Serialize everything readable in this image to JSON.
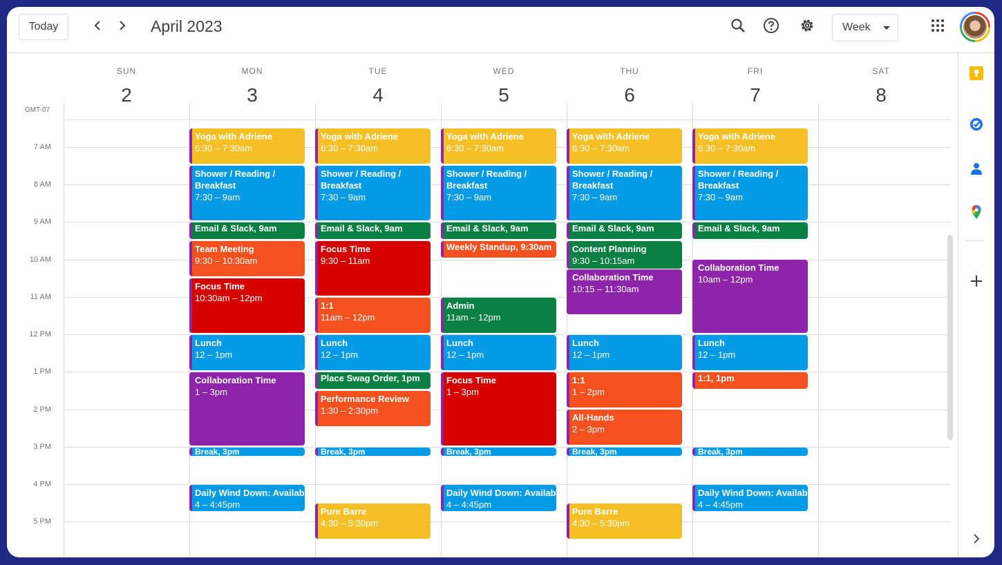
{
  "toolbar": {
    "today_label": "Today",
    "title": "April 2023",
    "view_label": "Week"
  },
  "timezone": "GMT-07",
  "days": [
    {
      "name": "SUN",
      "num": "2"
    },
    {
      "name": "MON",
      "num": "3"
    },
    {
      "name": "TUE",
      "num": "4"
    },
    {
      "name": "WED",
      "num": "5"
    },
    {
      "name": "THU",
      "num": "6"
    },
    {
      "name": "FRI",
      "num": "7"
    },
    {
      "name": "SAT",
      "num": "8"
    }
  ],
  "hours": [
    "7 AM",
    "8 AM",
    "9 AM",
    "10 AM",
    "11 AM",
    "12 PM",
    "1 PM",
    "2 PM",
    "3 PM",
    "4 PM",
    "5 PM"
  ],
  "colors": {
    "yellow": "#f6bf26",
    "blue": "#039be5",
    "green": "#0b8043",
    "orange": "#f4511e",
    "red": "#d50000",
    "purple": "#8e24aa"
  },
  "icons": {
    "search": "search-icon",
    "help": "help-icon",
    "settings": "gear-icon",
    "apps": "apps-grid-icon",
    "keep": "keep-icon",
    "tasks": "tasks-icon",
    "contacts": "contacts-icon",
    "maps": "maps-icon",
    "add": "plus-icon",
    "expand": "chevron-right-icon"
  },
  "events": {
    "mon": [
      {
        "title": "Yoga with Adriene",
        "time": "6:30 – 7:30am",
        "color": "yellow"
      },
      {
        "title": "Shower / Reading / Breakfast",
        "time": "7:30 – 9am",
        "color": "blue"
      },
      {
        "title": "Email & Slack, 9am",
        "time": "",
        "color": "green"
      },
      {
        "title": "Team Meeting",
        "time": "9:30 – 10:30am",
        "color": "orange"
      },
      {
        "title": "Focus Time",
        "time": "10:30am – 12pm",
        "color": "red"
      },
      {
        "title": "Lunch",
        "time": "12 – 1pm",
        "color": "blue"
      },
      {
        "title": "Collaboration Time",
        "time": "1 – 3pm",
        "color": "purple"
      },
      {
        "title": "Break, 3pm",
        "time": "",
        "color": "blue"
      },
      {
        "title": "Daily Wind Down: Available",
        "time": "4 – 4:45pm",
        "color": "blue"
      }
    ],
    "tue": [
      {
        "title": "Yoga with Adriene",
        "time": "6:30 – 7:30am",
        "color": "yellow"
      },
      {
        "title": "Shower / Reading / Breakfast",
        "time": "7:30 – 9am",
        "color": "blue"
      },
      {
        "title": "Email & Slack, 9am",
        "time": "",
        "color": "green"
      },
      {
        "title": "Focus Time",
        "time": "9:30 – 11am",
        "color": "red"
      },
      {
        "title": "1:1",
        "time": "11am – 12pm",
        "color": "orange"
      },
      {
        "title": "Lunch",
        "time": "12 – 1pm",
        "color": "blue"
      },
      {
        "title": "Place Swag Order, 1pm",
        "time": "",
        "color": "green"
      },
      {
        "title": "Performance Review",
        "time": "1:30 – 2:30pm",
        "color": "orange"
      },
      {
        "title": "Break, 3pm",
        "time": "",
        "color": "blue"
      },
      {
        "title": "Pure Barre",
        "time": "4:30 – 5:30pm",
        "color": "yellow"
      }
    ],
    "wed": [
      {
        "title": "Yoga with Adriene",
        "time": "6:30 – 7:30am",
        "color": "yellow"
      },
      {
        "title": "Shower / Reading / Breakfast",
        "time": "7:30 – 9am",
        "color": "blue"
      },
      {
        "title": "Email & Slack, 9am",
        "time": "",
        "color": "green"
      },
      {
        "title": "Weekly Standup, 9:30am",
        "time": "",
        "color": "orange"
      },
      {
        "title": "Admin",
        "time": "11am – 12pm",
        "color": "green"
      },
      {
        "title": "Lunch",
        "time": "12 – 1pm",
        "color": "blue"
      },
      {
        "title": "Focus Time",
        "time": "1 – 3pm",
        "color": "red"
      },
      {
        "title": "Break, 3pm",
        "time": "",
        "color": "blue"
      },
      {
        "title": "Daily Wind Down: Available",
        "time": "4 – 4:45pm",
        "color": "blue"
      }
    ],
    "thu": [
      {
        "title": "Yoga with Adriene",
        "time": "6:30 – 7:30am",
        "color": "yellow"
      },
      {
        "title": "Shower / Reading / Breakfast",
        "time": "7:30 – 9am",
        "color": "blue"
      },
      {
        "title": "Email & Slack, 9am",
        "time": "",
        "color": "green"
      },
      {
        "title": "Content Planning",
        "time": "9:30 – 10:15am",
        "color": "green"
      },
      {
        "title": "Collaboration Time",
        "time": "10:15 – 11:30am",
        "color": "purple"
      },
      {
        "title": "Lunch",
        "time": "12 – 1pm",
        "color": "blue"
      },
      {
        "title": "1:1",
        "time": "1 – 2pm",
        "color": "orange"
      },
      {
        "title": "All-Hands",
        "time": "2 – 3pm",
        "color": "orange"
      },
      {
        "title": "Break, 3pm",
        "time": "",
        "color": "blue"
      },
      {
        "title": "Pure Barre",
        "time": "4:30 – 5:30pm",
        "color": "yellow"
      }
    ],
    "fri": [
      {
        "title": "Yoga with Adriene",
        "time": "6:30 – 7:30am",
        "color": "yellow"
      },
      {
        "title": "Shower / Reading / Breakfast",
        "time": "7:30 – 9am",
        "color": "blue"
      },
      {
        "title": "Email & Slack, 9am",
        "time": "",
        "color": "green"
      },
      {
        "title": "Collaboration Time",
        "time": "10am – 12pm",
        "color": "purple"
      },
      {
        "title": "Lunch",
        "time": "12 – 1pm",
        "color": "blue"
      },
      {
        "title": "1:1, 1pm",
        "time": "",
        "color": "orange"
      },
      {
        "title": "Break, 3pm",
        "time": "",
        "color": "blue"
      },
      {
        "title": "Daily Wind Down: Available",
        "time": "4 – 4:45pm",
        "color": "blue"
      }
    ]
  }
}
